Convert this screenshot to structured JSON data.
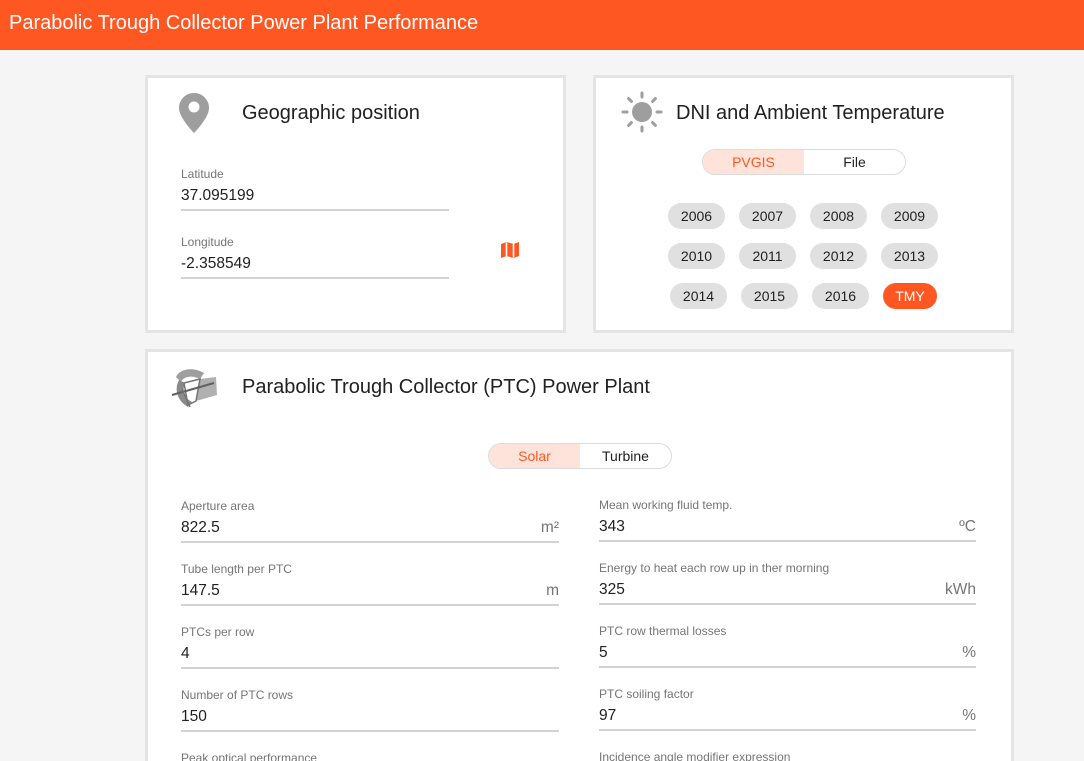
{
  "app": {
    "title": "Parabolic Trough Collector Power Plant Performance"
  },
  "geo": {
    "title": "Geographic position",
    "latitude_label": "Latitude",
    "latitude_value": "37.095199",
    "longitude_label": "Longitude",
    "longitude_value": "-2.358549"
  },
  "dni": {
    "title": "DNI and Ambient Temperature",
    "sources": [
      "PVGIS",
      "File"
    ],
    "selected_source": "PVGIS",
    "years": [
      "2006",
      "2007",
      "2008",
      "2009",
      "2010",
      "2011",
      "2012",
      "2013",
      "2014",
      "2015",
      "2016",
      "TMY"
    ],
    "selected_year": "TMY"
  },
  "ptc": {
    "title": "Parabolic Trough Collector (PTC) Power Plant",
    "tabs": [
      "Solar",
      "Turbine"
    ],
    "selected_tab": "Solar",
    "left_fields": [
      {
        "label": "Aperture area",
        "value": "822.5",
        "unit": "m²"
      },
      {
        "label": "Tube length per PTC",
        "value": "147.5",
        "unit": "m"
      },
      {
        "label": "PTCs per row",
        "value": "4",
        "unit": ""
      },
      {
        "label": "Number of PTC rows",
        "value": "150",
        "unit": ""
      },
      {
        "label": "Peak optical performance",
        "value": "",
        "unit": ""
      }
    ],
    "right_fields": [
      {
        "label": "Mean working fluid temp.",
        "value": "343",
        "unit": "ºC"
      },
      {
        "label": "Energy to heat each row up in ther morning",
        "value": "325",
        "unit": "kWh"
      },
      {
        "label": "PTC row thermal losses",
        "value": "5",
        "unit": "%"
      },
      {
        "label": "PTC soiling factor",
        "value": "97",
        "unit": "%"
      },
      {
        "label": "Incidence angle modifier expression",
        "value": "",
        "unit": ""
      }
    ]
  },
  "colors": {
    "accent": "#ff5722",
    "accent_light": "#fde3da",
    "chip": "#e0e0e0"
  },
  "icons": {
    "geo": "map-pin-icon",
    "map": "map-icon",
    "dni": "sun-icon",
    "ptc": "trough-collector-icon"
  }
}
